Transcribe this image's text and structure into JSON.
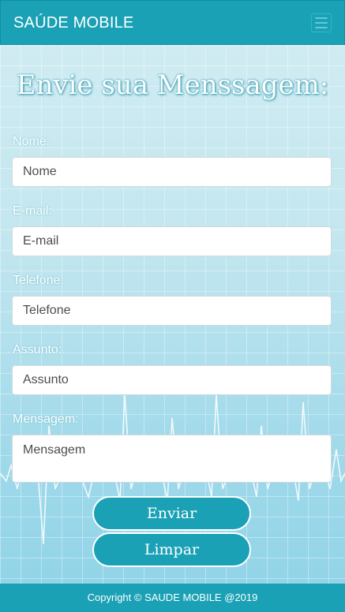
{
  "navbar": {
    "brand": "SAÚDE MOBILE",
    "menu_icon": "hamburger-icon"
  },
  "form": {
    "title": "Envie sua Menssagem:",
    "fields": {
      "nome": {
        "label": "Nome:",
        "placeholder": "Nome"
      },
      "email": {
        "label": "E-mail:",
        "placeholder": "E-mail"
      },
      "telefone": {
        "label": "Telefone:",
        "placeholder": "Telefone"
      },
      "assunto": {
        "label": "Assunto:",
        "placeholder": "Assunto"
      },
      "mensagem": {
        "label": "Mensagem:",
        "placeholder": "Mensagem"
      }
    },
    "buttons": {
      "submit": "Enviar",
      "reset": "Limpar"
    }
  },
  "footer": {
    "text": "Copyright © SAUDE MOBILE @2019"
  },
  "colors": {
    "primary": "#1aa1b5",
    "background": "#c2e6ef"
  }
}
